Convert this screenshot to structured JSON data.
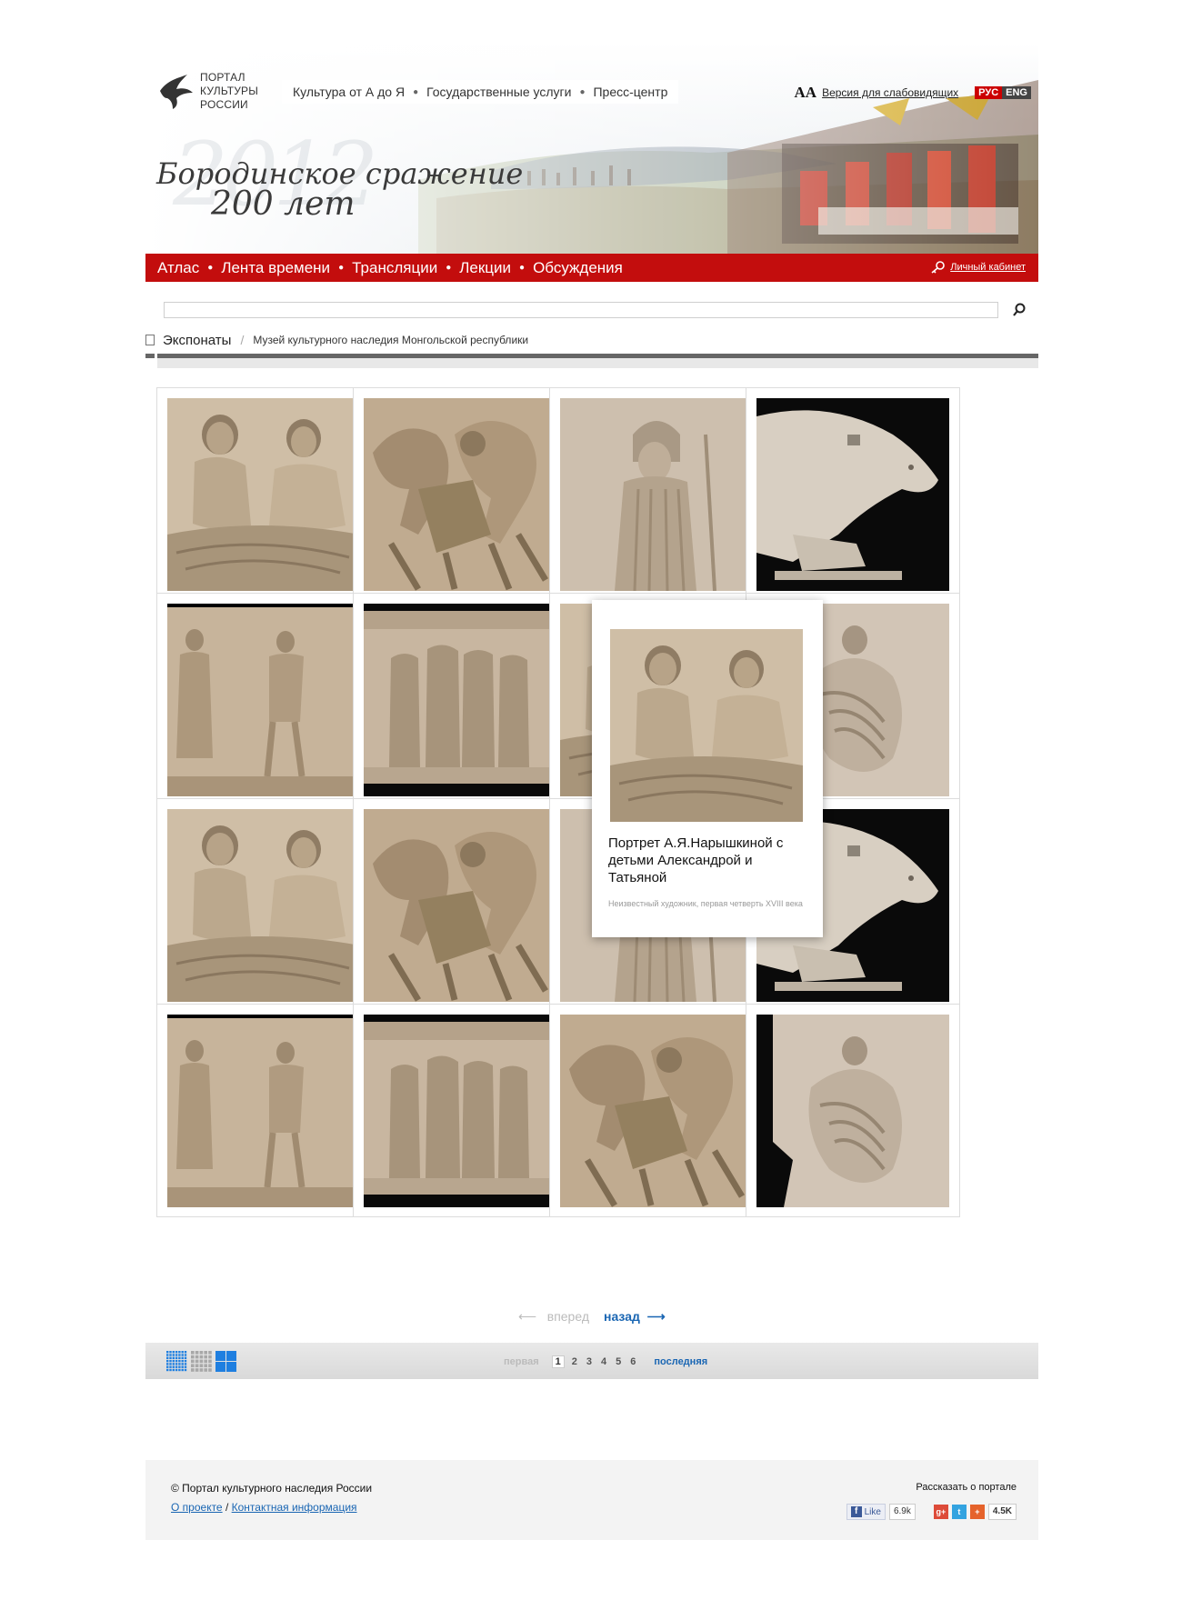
{
  "header": {
    "logo_lines": [
      "ПОРТАЛ",
      "КУЛЬТУРЫ",
      "РОССИИ"
    ],
    "top_nav": [
      "Культура от А до Я",
      "Государственные услуги",
      "Пресс-центр"
    ],
    "accessibility_glyph": "АА",
    "accessibility_link": "Версия для слабовидящих",
    "lang_ru": "РУС",
    "lang_en": "ENG",
    "banner_line1": "Бородинское сражение",
    "banner_line2": "200 лет"
  },
  "main_menu": {
    "items": [
      "Атлас",
      "Лента времени",
      "Трансляции",
      "Лекции",
      "Обсуждения"
    ],
    "cabinet": "Личный кабинет"
  },
  "search": {
    "placeholder": "",
    "value": ""
  },
  "breadcrumb": {
    "section": "Экспонаты",
    "current": "Музей культурного наследия Монгольской республики"
  },
  "gallery": {
    "tiles": [
      "relief-two-men",
      "relief-horsemen",
      "relief-athena",
      "relief-dog",
      "relief-standing-figures",
      "relief-procession",
      "relief-two-men",
      "relief-flame-figure",
      "relief-two-men",
      "relief-horsemen",
      "relief-athena",
      "relief-dog",
      "relief-standing-figures",
      "relief-procession",
      "relief-horsemen",
      "relief-flame-figure"
    ],
    "popup": {
      "title": "Портрет А.Я.Нарышкиной с детьми Александрой и Татьяной",
      "meta": "Неизвестный художник, первая четверть XVIII века"
    }
  },
  "pagination": {
    "prev_label": "вперед",
    "next_label": "назад",
    "first": "первая",
    "pages": [
      "1",
      "2",
      "3",
      "4",
      "5",
      "6"
    ],
    "current": "1",
    "last": "последняя"
  },
  "footer": {
    "copyright": "© Портал культурного наследия России",
    "about": "О проекте",
    "sep": "/",
    "contacts": "Контактная информация",
    "share_title": "Рассказать о портале",
    "fb_like": "Like",
    "fb_count": "6.9k",
    "share_count": "4.5K"
  },
  "colors": {
    "accent_red": "#c30d0d",
    "link_blue": "#1a66b3",
    "view_active": "#1f7fe0"
  }
}
